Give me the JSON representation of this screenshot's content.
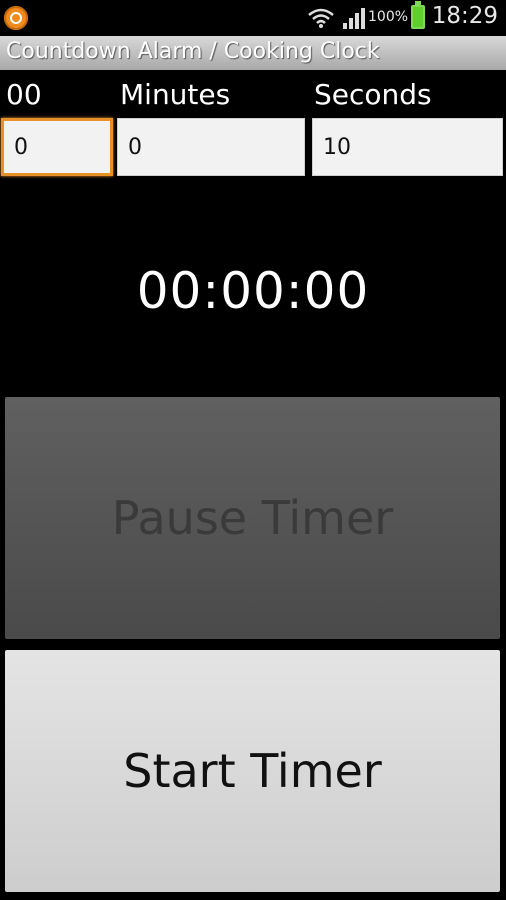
{
  "status_bar": {
    "battery_percent": "100%",
    "time": "18:29",
    "icons": [
      "app-notification-icon",
      "wifi-icon",
      "signal-icon",
      "battery-icon"
    ]
  },
  "app": {
    "title": "Countdown Alarm / Cooking Clock"
  },
  "fields": {
    "hours": {
      "label": "00",
      "value": "0"
    },
    "minutes": {
      "label": "Minutes",
      "value": "0"
    },
    "seconds": {
      "label": "Seconds",
      "value": "10"
    }
  },
  "countdown": {
    "display": "00:00:00"
  },
  "buttons": {
    "pause_label": "Pause Timer",
    "start_label": "Start Timer"
  },
  "colors": {
    "focus_accent": "#e8902a",
    "battery_green": "#5fcf2e",
    "pause_button_bg": "#555555",
    "start_button_bg": "#d9d9d9"
  }
}
